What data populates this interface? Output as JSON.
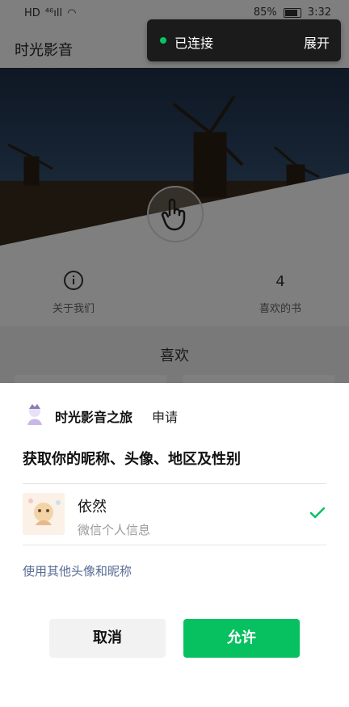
{
  "status_bar": {
    "left_icons": [
      "hd-icon",
      "4g-signal-icon",
      "wifi-icon"
    ],
    "left_text": "HD ⁴⁶ıll ✓",
    "battery": "85%",
    "battery_level": 0.85,
    "time": "3:32"
  },
  "header": {
    "title": "时光影音",
    "capsule_dots": "•••"
  },
  "toast": {
    "status": "已连接",
    "action": "展开",
    "dot_color": "#09c561"
  },
  "stats": [
    {
      "value": "",
      "label": "关于我们",
      "icon": "info-icon"
    },
    {
      "value": "4",
      "label": "喜欢的书"
    }
  ],
  "section": {
    "title": "喜欢"
  },
  "sheet": {
    "app_name": "时光影音之旅",
    "apply": "申请",
    "permission_title": "获取你的昵称、头像、地区及性别",
    "user_name": "依然",
    "user_sub": "微信个人信息",
    "use_other": "使用其他头像和昵称",
    "cancel": "取消",
    "allow": "允许",
    "accent_color": "#07c160",
    "link_color": "#576b95"
  }
}
